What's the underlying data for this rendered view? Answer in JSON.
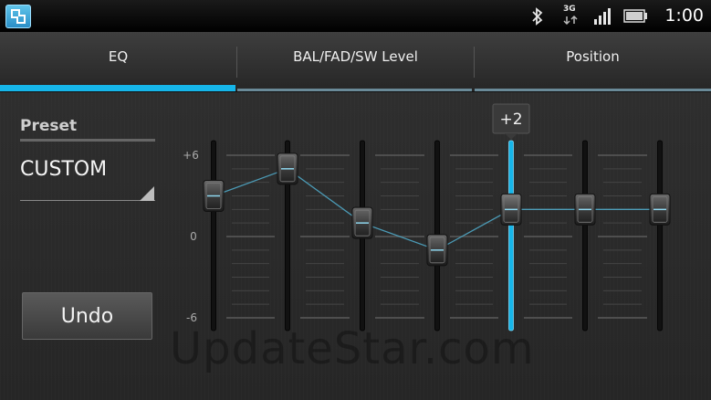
{
  "status_bar": {
    "time": "1:00",
    "network_label": "3G",
    "icons": [
      "app-icon",
      "bluetooth-icon",
      "signal-3g-icon",
      "signal-bars-icon",
      "battery-icon"
    ]
  },
  "tabs": [
    {
      "label": "EQ",
      "active": true
    },
    {
      "label": "BAL/FAD/SW Level",
      "active": false
    },
    {
      "label": "Position",
      "active": false
    }
  ],
  "preset": {
    "label": "Preset",
    "value": "CUSTOM"
  },
  "undo_label": "Undo",
  "equalizer": {
    "y_labels": {
      "top": "+6",
      "mid": "0",
      "bottom": "-6"
    },
    "range": [
      -6,
      6
    ],
    "bands": [
      3,
      5,
      1,
      -1,
      2,
      2,
      2
    ],
    "selected_band": 4,
    "tooltip": "+2",
    "accent": "#16b6ea"
  },
  "watermark": "UpdateStar.com"
}
